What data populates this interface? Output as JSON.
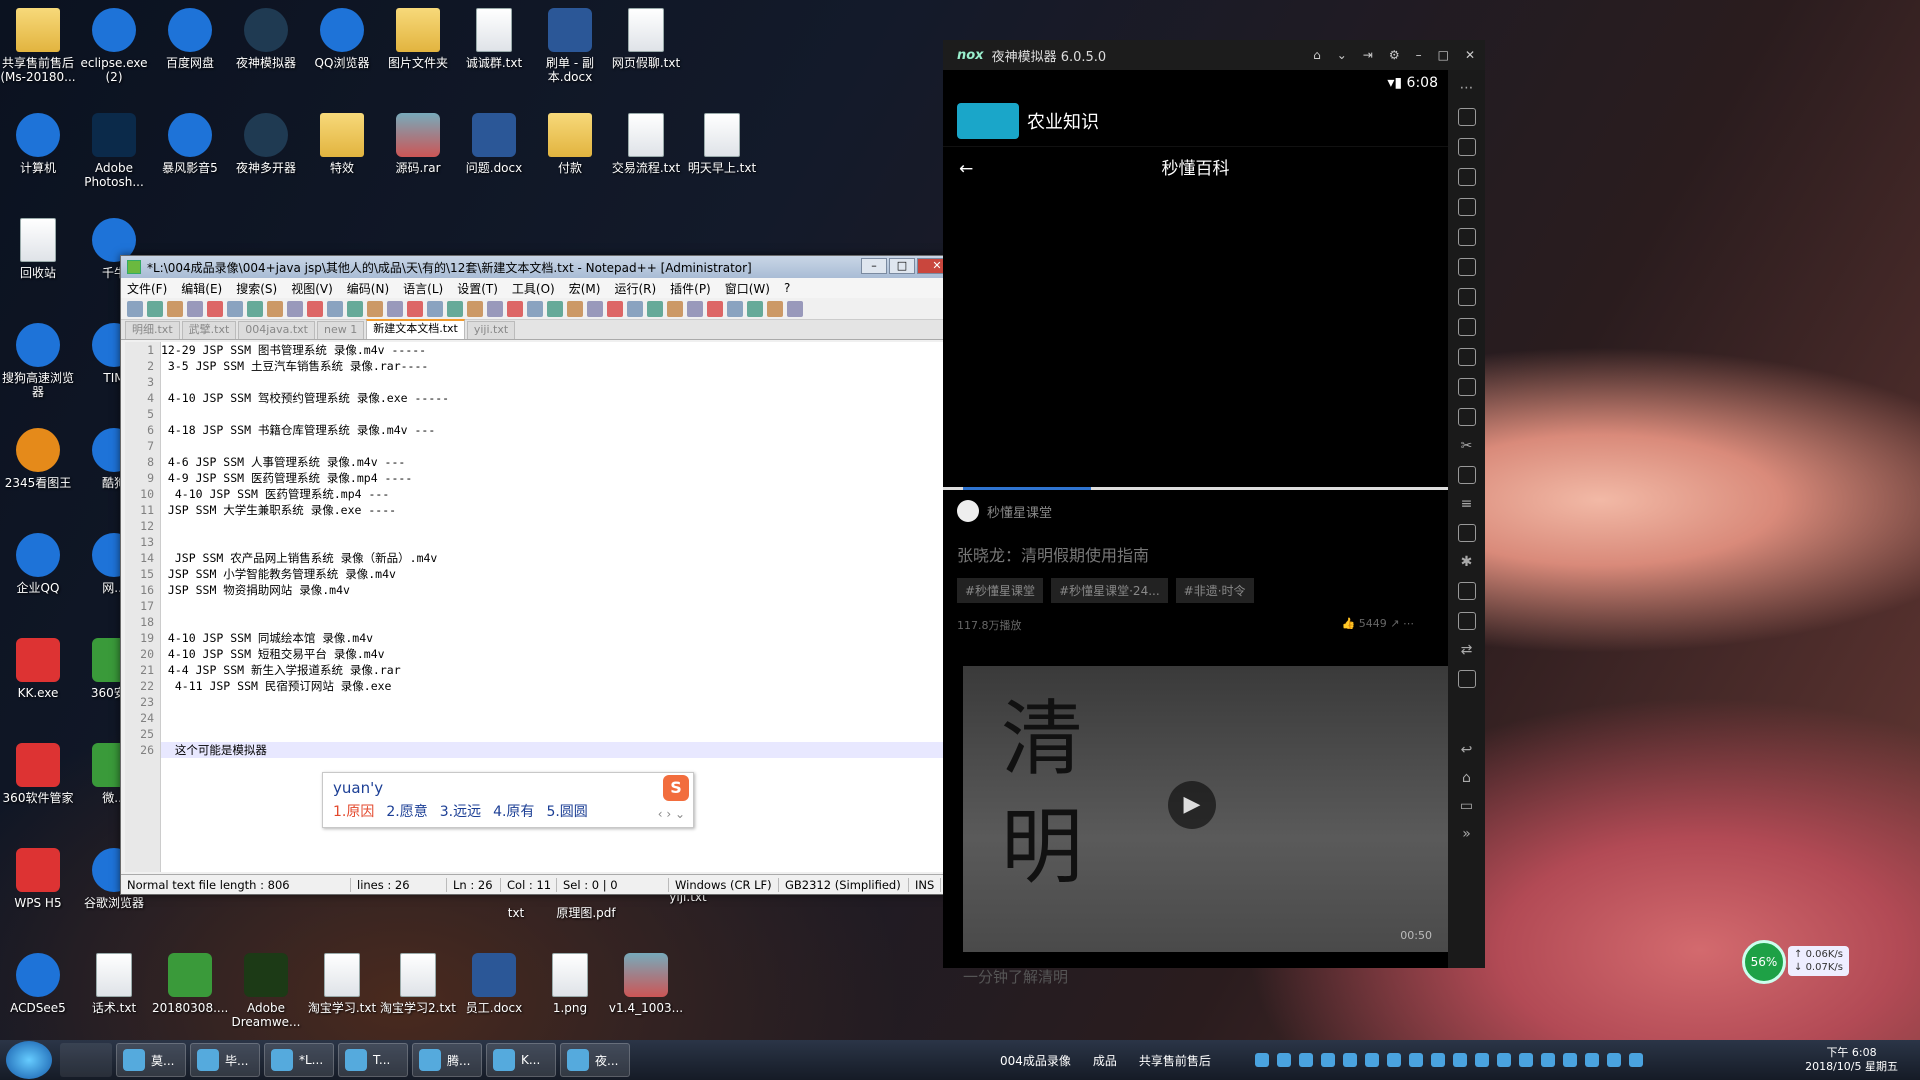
{
  "desktop": {
    "icons": [
      {
        "label": "共享售前售后(Ms-20180..."
      },
      {
        "label": "eclipse.exe (2)"
      },
      {
        "label": "百度网盘"
      },
      {
        "label": "夜神模拟器"
      },
      {
        "label": "QQ浏览器"
      },
      {
        "label": "图片文件夹"
      },
      {
        "label": "诚诚群.txt"
      },
      {
        "label": "刷单 - 副本.docx"
      },
      {
        "label": "网页假聊.txt"
      },
      {
        "label": "计算机"
      },
      {
        "label": "Adobe Photosh..."
      },
      {
        "label": "暴风影音5"
      },
      {
        "label": "夜神多开器"
      },
      {
        "label": "特效"
      },
      {
        "label": "源码.rar"
      },
      {
        "label": "问题.docx"
      },
      {
        "label": "付款"
      },
      {
        "label": "交易流程.txt"
      },
      {
        "label": "明天早上.txt"
      },
      {
        "label": "回收站"
      },
      {
        "label": "千牛"
      },
      {
        "label": "搜狗高速浏览器"
      },
      {
        "label": "TIM"
      },
      {
        "label": "2345看图王"
      },
      {
        "label": "酷狗"
      },
      {
        "label": "企业QQ"
      },
      {
        "label": "网..."
      },
      {
        "label": "KK.exe"
      },
      {
        "label": "360安..."
      },
      {
        "label": "360软件管家"
      },
      {
        "label": "微..."
      },
      {
        "label": "WPS H5"
      },
      {
        "label": "谷歌浏览器"
      },
      {
        "label": "ACDSee5"
      },
      {
        "label": "话术.txt"
      },
      {
        "label": "20180308...."
      },
      {
        "label": "Adobe Dreamwe..."
      },
      {
        "label": "淘宝学习.txt"
      },
      {
        "label": "淘宝学习2.txt"
      },
      {
        "label": "员工.docx"
      },
      {
        "label": "1.png"
      },
      {
        "label": "v1.4_1003..."
      }
    ],
    "partial_labels": [
      "txt",
      "原理图.pdf",
      "yiji.txt"
    ]
  },
  "notepad": {
    "title": "*L:\\004成品录像\\004+java jsp\\其他人的\\成品\\天\\有的\\12套\\新建文本文档.txt - Notepad++ [Administrator]",
    "menu": [
      "文件(F)",
      "编辑(E)",
      "搜索(S)",
      "视图(V)",
      "编码(N)",
      "语言(L)",
      "设置(T)",
      "工具(O)",
      "宏(M)",
      "运行(R)",
      "插件(P)",
      "窗口(W)",
      "?"
    ],
    "menu_close": "X",
    "tabs": [
      "明细.txt",
      "武擘.txt",
      "004java.txt",
      "new 1",
      "新建文本文档.txt",
      "yiji.txt"
    ],
    "active_tab": 4,
    "lines": [
      "12-29 JSP SSM 图书管理系统 录像.m4v -----",
      " 3-5 JSP SSM 土豆汽车销售系统 录像.rar----",
      "",
      " 4-10 JSP SSM 驾校预约管理系统 录像.exe -----",
      "",
      " 4-18 JSP SSM 书籍仓库管理系统 录像.m4v ---",
      "",
      " 4-6 JSP SSM 人事管理系统 录像.m4v ---",
      " 4-9 JSP SSM 医药管理系统 录像.mp4 ----",
      "  4-10 JSP SSM 医药管理系统.mp4 ---",
      " JSP SSM 大学生兼职系统 录像.exe ----",
      "",
      "",
      "  JSP SSM 农产品网上销售系统 录像（新品）.m4v",
      " JSP SSM 小学智能教务管理系统 录像.m4v",
      " JSP SSM 物资捐助网站 录像.m4v",
      "",
      "",
      " 4-10 JSP SSM 同城绘本馆 录像.m4v",
      " 4-10 JSP SSM 短租交易平台 录像.m4v",
      " 4-4 JSP SSM 新生入学报道系统 录像.rar",
      "  4-11 JSP SSM 民宿预订网站 录像.exe",
      "",
      "",
      "",
      "  这个可能是模拟器"
    ],
    "status": {
      "type": "Normal text file  length : 806",
      "lines": "lines : 26",
      "pos": "Ln : 26",
      "col": "Col : 11",
      "sel": "Sel : 0 | 0",
      "eol": "Windows (CR LF)",
      "enc": "GB2312 (Simplified)",
      "mode": "INS"
    }
  },
  "ime": {
    "composition": "yuan'y",
    "candidates": [
      "1.原因",
      "2.愿意",
      "3.远远",
      "4.原有",
      "5.圆圆"
    ],
    "logo": "S",
    "nav": "‹ › ⌄"
  },
  "nox": {
    "logo": "nox",
    "title": "夜神模拟器 6.0.5.0",
    "status_time": "6:08",
    "app_title": "农业知识",
    "page_title": "秒懂百科",
    "back": "←",
    "channel": "秒懂星课堂",
    "video_title": "张晓龙：清明假期使用指南",
    "tags": [
      "#秒懂星课堂",
      "#秒懂星课堂·24...",
      "#非遗·时令"
    ],
    "views": "117.8万播放",
    "likes": "5449",
    "thumb_text": "清\n明",
    "duration": "00:50",
    "caption": "一分钟了解清明"
  },
  "speed": {
    "percent": "56%",
    "up": "0.06K/s",
    "down": "0.07K/s"
  },
  "taskbar": {
    "tasks": [
      "莫...",
      "毕...",
      "*L...",
      "T...",
      "腾...",
      "K...",
      "夜..."
    ],
    "toolbars": [
      "004成品录像",
      "成品",
      "共享售前售后"
    ],
    "clock_time": "下午 6:08",
    "clock_date": "2018/10/5 星期五"
  }
}
